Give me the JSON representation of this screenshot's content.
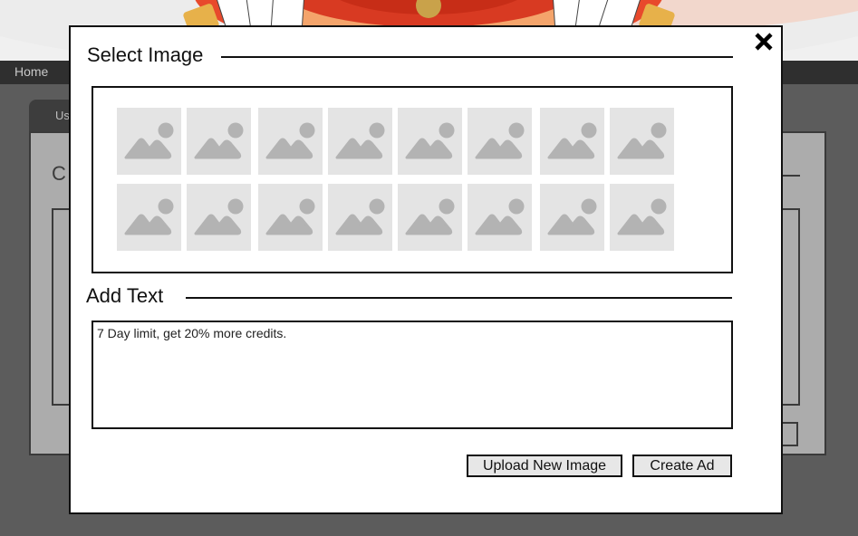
{
  "background": {
    "nav": {
      "home_label": "Home"
    },
    "tab_label": "Us",
    "panel_title": "C"
  },
  "modal": {
    "select_image_title": "Select Image",
    "add_text_title": "Add Text",
    "ad_text": "7 Day limit, get 20% more credits.",
    "upload_button": "Upload New Image",
    "create_button": "Create Ad",
    "thumbnail_icon": "image-placeholder-icon",
    "close_icon": "close-icon",
    "image_rows": 2,
    "images_per_row": 8
  },
  "colors": {
    "modal_bg": "#ffffff",
    "border": "#111111",
    "thumb_bg": "#e4e4e4",
    "thumb_icon": "#b3b3b3",
    "button_bg": "#e7e7e7",
    "overlay": "#5c5c5c",
    "banner_red": "#e8492c"
  }
}
